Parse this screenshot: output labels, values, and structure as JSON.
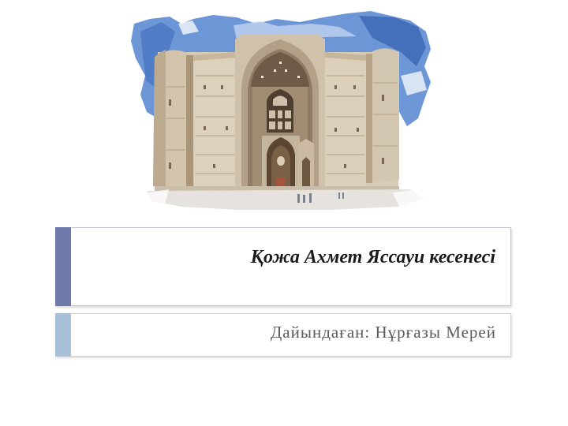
{
  "slide": {
    "title": "Қожа Ахмет Яссауи кесенесі",
    "subtitle": "Дайындаған: Нұрғазы Мерей"
  },
  "colors": {
    "title_accent": "#6f79aa",
    "subtitle_accent": "#a6c0d6",
    "title_text": "#1a1a1a",
    "subtitle_text": "#5a5a5a"
  }
}
